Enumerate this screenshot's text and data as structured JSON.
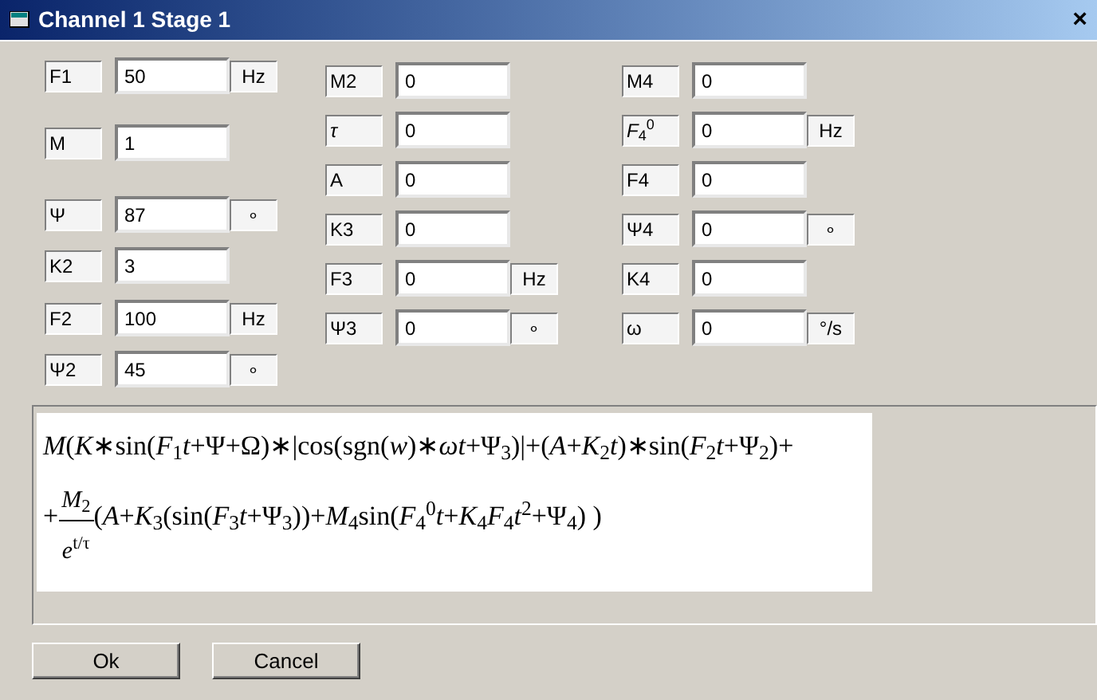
{
  "window": {
    "title": "Channel 1 Stage 1",
    "close": "×"
  },
  "columns": [
    {
      "fields": [
        {
          "label": "F1",
          "value": "50",
          "unit": "Hz"
        },
        {
          "label": "M",
          "value": "1"
        },
        {
          "label": "Ψ",
          "value": "87",
          "unit": "∘"
        },
        {
          "label": "K2",
          "value": "3"
        },
        {
          "label": "F2",
          "value": "100",
          "unit": "Hz"
        },
        {
          "label": "Ψ2",
          "value": "45",
          "unit": "∘"
        }
      ]
    },
    {
      "fields": [
        {
          "label": "M2",
          "value": "0"
        },
        {
          "label": "*τ*",
          "value": "0"
        },
        {
          "label": "A",
          "value": "0"
        },
        {
          "label": "K3",
          "value": "0"
        },
        {
          "label": "F3",
          "value": "0",
          "unit": "Hz"
        },
        {
          "label": "Ψ3",
          "value": "0",
          "unit": "∘"
        }
      ]
    },
    {
      "fields": [
        {
          "label": "M4",
          "value": "0"
        },
        {
          "label": "*F*$_{4}$$^{0}$",
          "value": "0",
          "unit": "Hz"
        },
        {
          "label": "F4",
          "value": "0"
        },
        {
          "label": "Ψ4",
          "value": "0",
          "unit": "∘"
        },
        {
          "label": "K4",
          "value": "0"
        },
        {
          "label": "ω",
          "value": "0",
          "unit": "°/s"
        }
      ]
    }
  ],
  "formula": {
    "line_1": "*M*(*K*∗sin(*F*$_{1}$*t*+Ψ+Ω)∗|cos(sgn(*w*)∗*ωt*+Ψ$_{3}$)|+(*A*+*K*$_{2}$*t*)∗sin(*F*$_{2}$*t*+Ψ$_{2}$)+",
    "line_2_start": "+",
    "numerator": "*M*$_{2}$",
    "denominator": "*e*$^{t/τ}$",
    "line_2_rest": "(*A*+*K*$_{3}$(sin(*F*$_{3}$*t*+Ψ$_{3}$))+*M*$_{4}$sin(*F*$_{4}$$^{0}$*t*+*K*$_{4}$*F*$_{4}$*t*$^{2}$+Ψ$_{4}$) )"
  },
  "buttons": [
    "Ok",
    "Cancel"
  ]
}
